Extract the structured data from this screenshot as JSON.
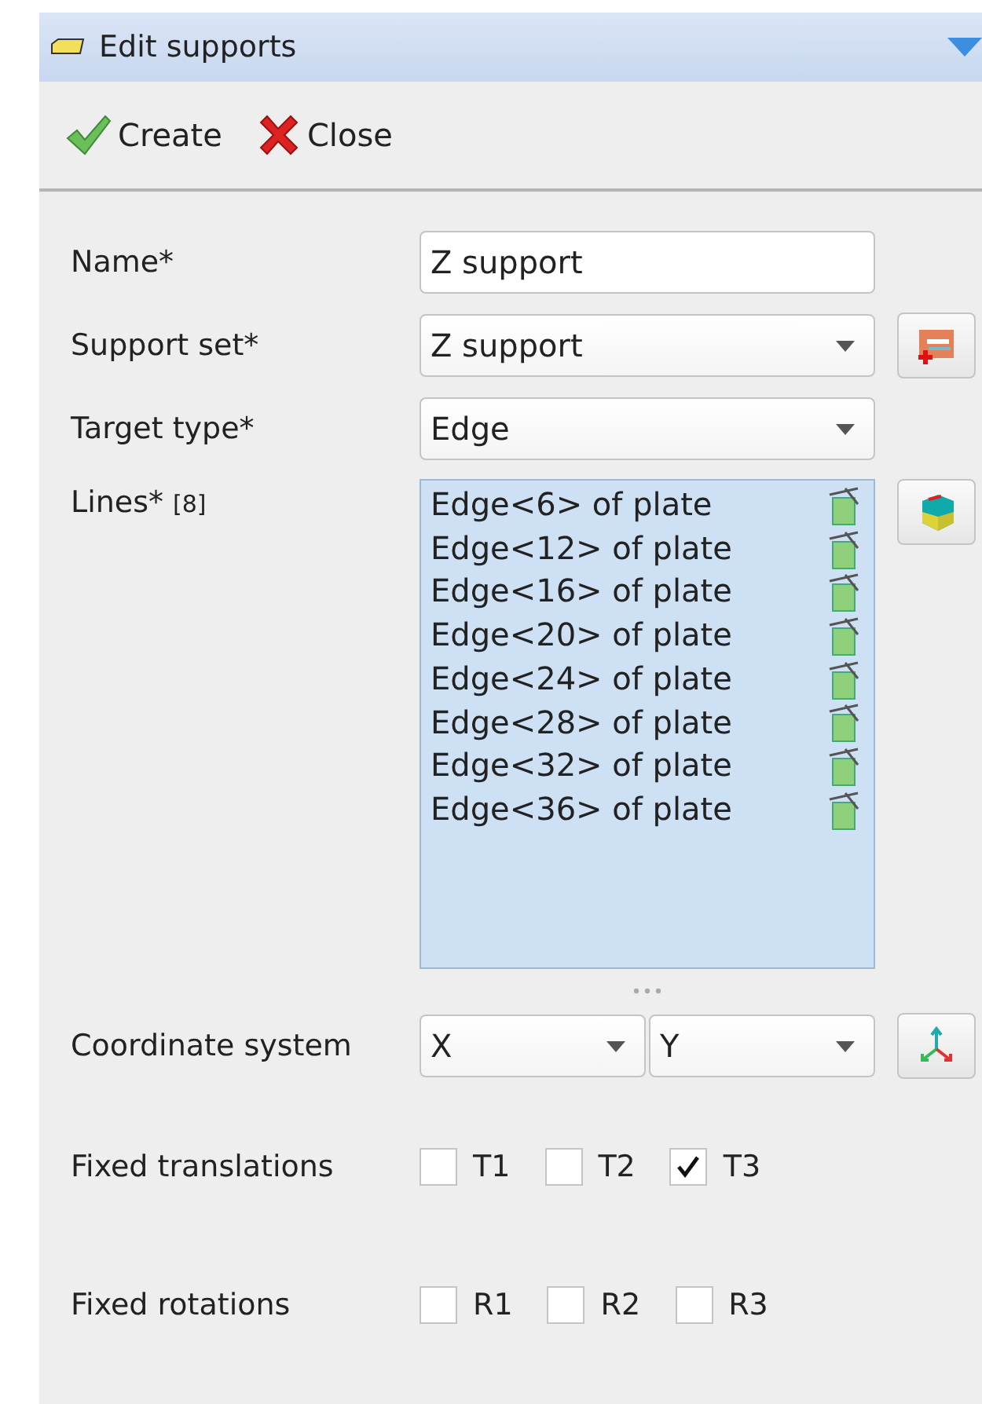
{
  "panel": {
    "title": "Edit supports"
  },
  "toolbar": [
    {
      "kind": "create",
      "label": "Create"
    },
    {
      "kind": "close",
      "label": "Close"
    }
  ],
  "name": {
    "label": "Name*",
    "value": "Z support"
  },
  "support_set": {
    "label": "Support set*",
    "value": "Z support"
  },
  "target_type": {
    "label": "Target type*",
    "value": "Edge"
  },
  "lines": {
    "label": "Lines*",
    "count": "[8]",
    "items": [
      "Edge<6> of plate",
      "Edge<12> of plate",
      "Edge<16> of plate",
      "Edge<20> of plate",
      "Edge<24> of plate",
      "Edge<28> of plate",
      "Edge<32> of plate",
      "Edge<36> of plate"
    ]
  },
  "coordinate_system": {
    "label": "Coordinate system",
    "first": "X",
    "second": "Y"
  },
  "fixed_translations": {
    "label": "Fixed translations",
    "options": [
      {
        "label": "T1",
        "checked": false
      },
      {
        "label": "T2",
        "checked": false
      },
      {
        "label": "T3",
        "checked": true
      }
    ]
  },
  "fixed_rotations": {
    "label": "Fixed rotations",
    "options": [
      {
        "label": "R1",
        "checked": false
      },
      {
        "label": "R2",
        "checked": false
      },
      {
        "label": "R3",
        "checked": false
      }
    ]
  }
}
